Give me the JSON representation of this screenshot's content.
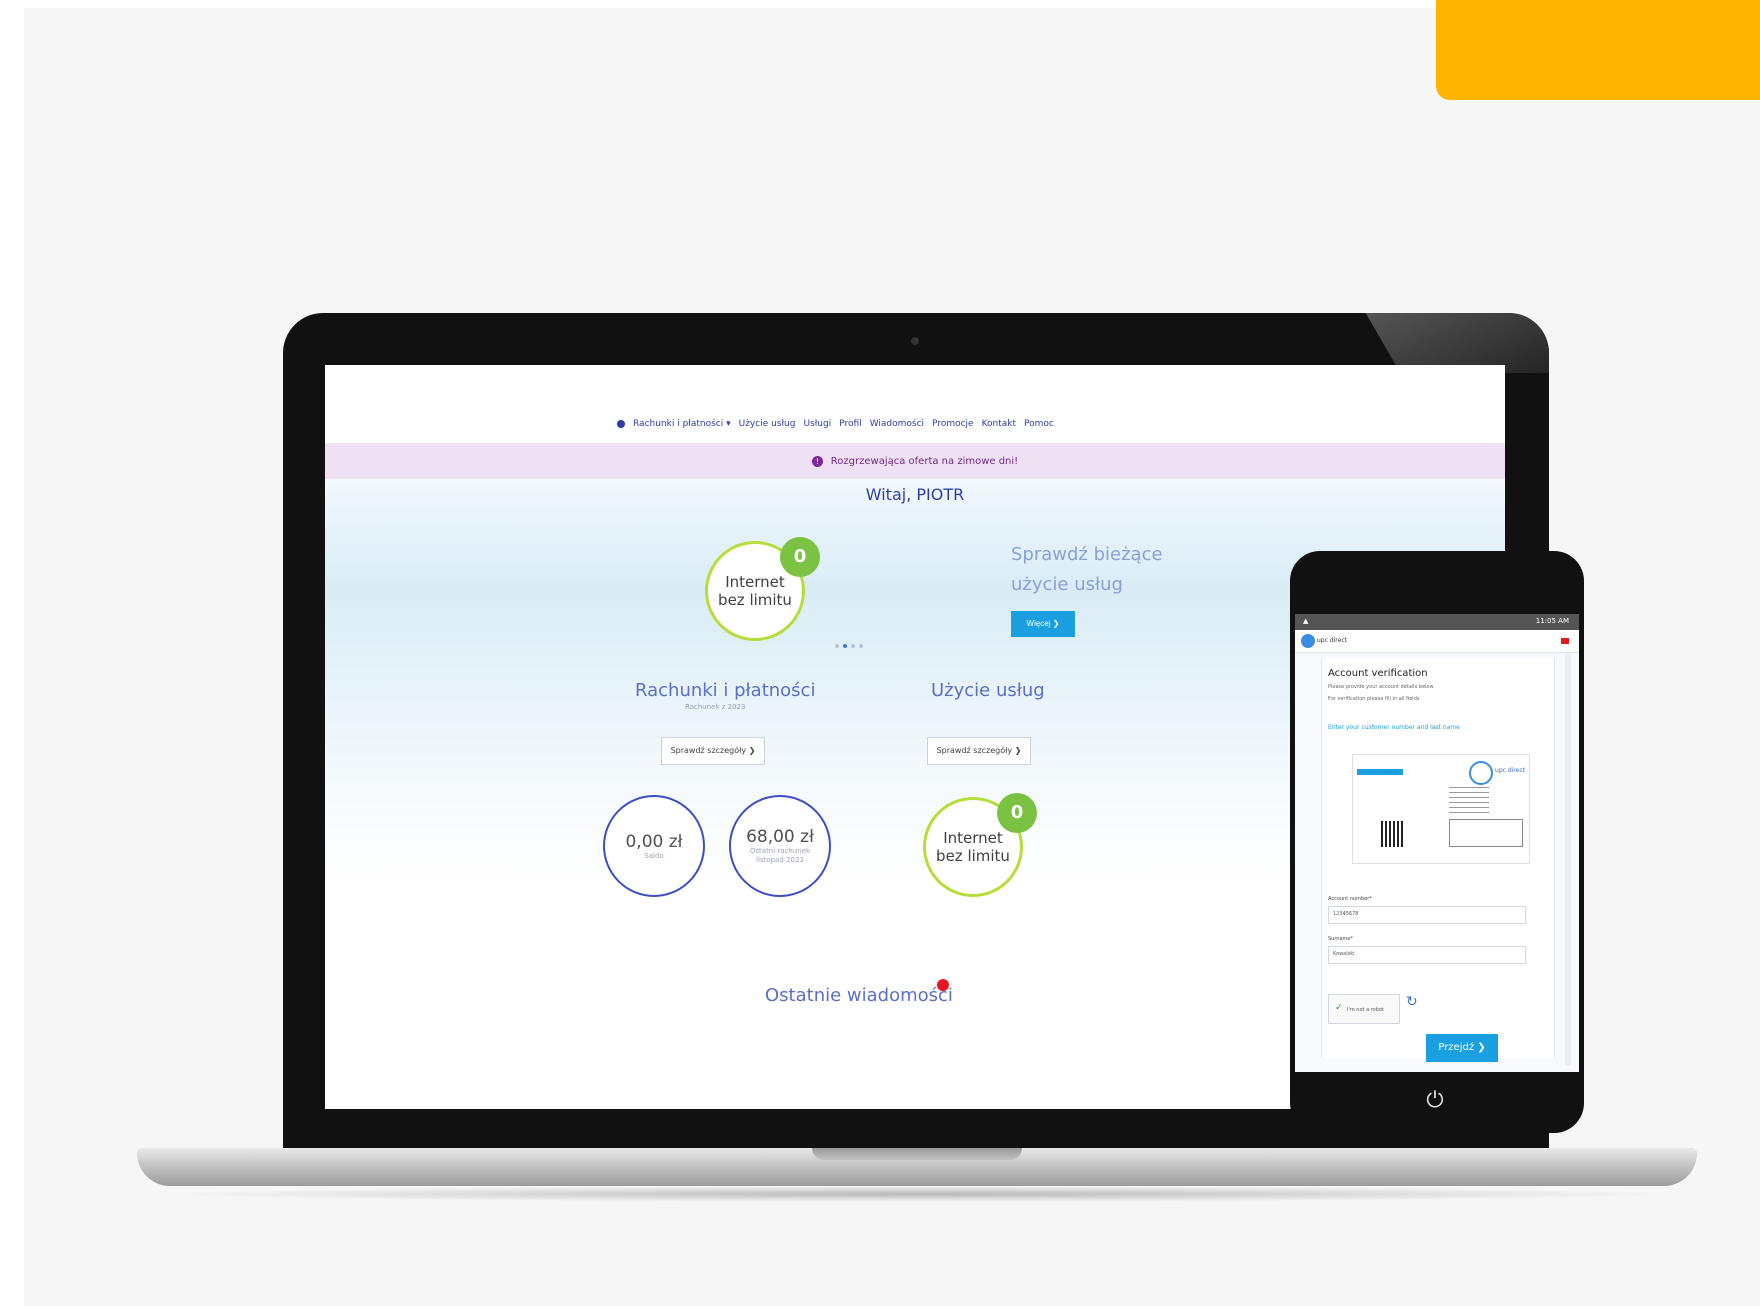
{
  "nav": {
    "items": [
      "Rachunki i płatności ▾",
      "Użycie usług",
      "Usługi",
      "Profil",
      "Wiadomości",
      "Promocje",
      "Kontakt",
      "Pomoc"
    ]
  },
  "promo": {
    "icon": "info-icon",
    "text": "Rozgrzewająca oferta na zimowe dni!"
  },
  "greeting": "Witaj, PIOTR",
  "hero": {
    "circle_text_1": "Internet",
    "circle_text_2": "bez limitu",
    "badge": "0",
    "title_1": "Sprawdź bieżące",
    "title_2": "użycie usług",
    "button": "Więcej ❯"
  },
  "billing": {
    "title": "Rachunki i płatności",
    "subtitle": "Rachunek z 2023",
    "button": "Sprawdź szczegóły ❯",
    "balance": "0,00 zł",
    "balance_sub": "Saldo",
    "invoice": "68,00 zł",
    "invoice_sub_1": "Ostatni rachunek",
    "invoice_sub_2": "listopad 2023"
  },
  "usage": {
    "title": "Użycie usług",
    "button": "Sprawdź szczegóły ❯",
    "circle_text_1": "Internet",
    "circle_text_2": "bez limitu",
    "badge": "0"
  },
  "messages": {
    "title": "Ostatnie wiadomości"
  },
  "phone": {
    "status_time": "11:05 AM",
    "app_name": "upc direct",
    "card_title": "Account verification",
    "line_1": "Please provide your account details below",
    "line_2": "For verification please fill in all fields",
    "link": "Enter your customer number and last name",
    "doc_logo_text": "upc direct",
    "field1_label": "Account number*",
    "field1_value": "12345678",
    "field2_label": "Surname*",
    "field2_value": "Kowalski",
    "captcha_text": "I'm not a robot",
    "next": "Przejdź ❯"
  },
  "colors": {
    "accent": "#ffb400",
    "brand_blue": "#2b3ea8",
    "button_blue": "#1aa0e0",
    "green": "#b6dd3a"
  }
}
